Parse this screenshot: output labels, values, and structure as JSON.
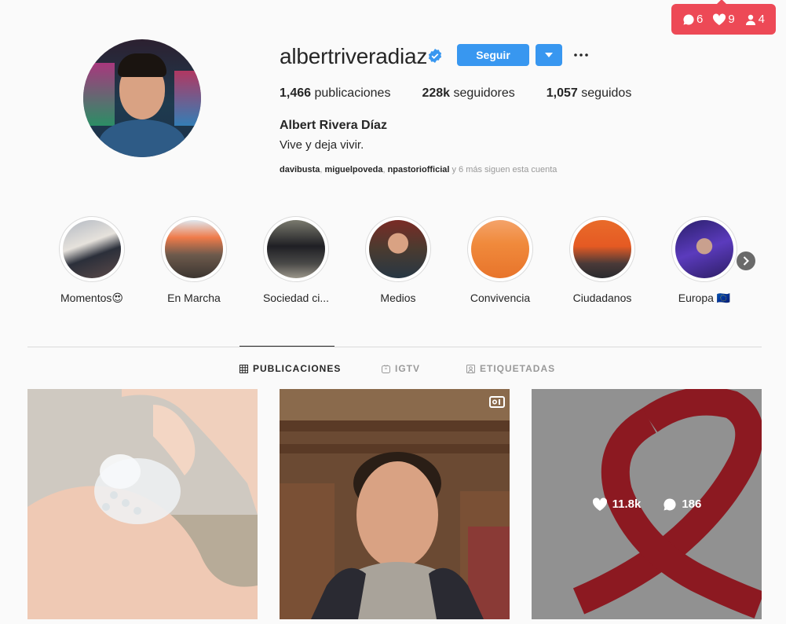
{
  "notifications": {
    "comments": "6",
    "likes": "9",
    "followers": "4",
    "color": "#ed4956"
  },
  "profile": {
    "username": "albertriveradiaz",
    "verified": true,
    "follow_label": "Seguir",
    "stats": [
      {
        "value": "1,466",
        "label": "publicaciones"
      },
      {
        "value": "228k",
        "label": "seguidores"
      },
      {
        "value": "1,057",
        "label": "seguidos"
      }
    ],
    "full_name": "Albert Rivera Díaz",
    "bio": "Vive y deja vivir.",
    "followed_by": {
      "users": [
        "davibusta",
        "miguelpoveda",
        "npastoriofficial"
      ],
      "more": " y 6 más siguen esta cuenta"
    }
  },
  "highlights": [
    {
      "label": "Momentos😍"
    },
    {
      "label": "En Marcha"
    },
    {
      "label": "Sociedad ci..."
    },
    {
      "label": "Medios"
    },
    {
      "label": "Convivencia"
    },
    {
      "label": "Ciudadanos"
    },
    {
      "label": "Europa 🇪🇺"
    }
  ],
  "tabs": [
    {
      "label": "PUBLICACIONES",
      "active": true
    },
    {
      "label": "IGTV",
      "active": false
    },
    {
      "label": "ETIQUETADAS",
      "active": false
    }
  ],
  "posts": [
    {
      "kind": "photo"
    },
    {
      "kind": "video"
    },
    {
      "kind": "photo",
      "hover": {
        "likes": "11.8k",
        "comments": "186"
      }
    }
  ],
  "accent_color": "#3897f0"
}
